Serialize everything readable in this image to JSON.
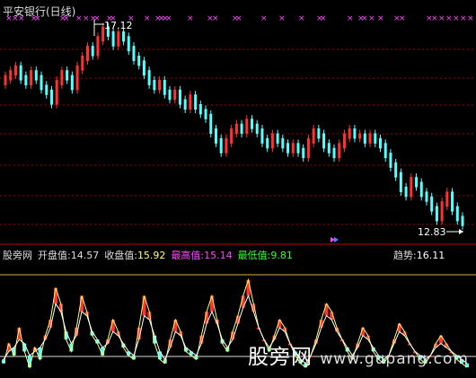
{
  "header": {
    "title": "平安银行(日线)"
  },
  "price_panel": {
    "high_label": "17.12",
    "low_label": "12.83"
  },
  "indicator_bar": {
    "name": "股旁网",
    "open_label": "开盘值:",
    "open_value": "14.57",
    "close_label": "收盘值:",
    "close_value": "15.92",
    "high_label": "最高值:",
    "high_value": "15.14",
    "low_label": "最低值:",
    "low_value": "9.81",
    "trend_label": "趋势:",
    "trend_value": "16.11"
  },
  "watermark": {
    "text": "股旁网",
    "url": "www.gupang.com"
  },
  "colors": {
    "up": "#ff3232",
    "down": "#54ffff",
    "grid": "#a00000",
    "yellow_line": "#ffff66",
    "white_line": "#ffffff",
    "magenta": "#ff44ff",
    "green": "#33ff33",
    "separator": "#c00000"
  },
  "chart_data": [
    {
      "type": "candlestick",
      "series": [
        {
          "name": "price",
          "values": [
            16.0,
            16.1,
            16.2,
            16.0,
            15.9,
            16.1,
            16.0,
            15.8,
            15.7,
            15.5,
            15.9,
            16.1,
            16.0,
            15.8,
            16.2,
            16.4,
            16.6,
            16.5,
            16.8,
            17.0,
            16.9,
            16.7,
            16.9,
            16.8,
            16.6,
            16.4,
            16.3,
            16.1,
            15.9,
            15.8,
            15.9,
            15.7,
            15.6,
            15.7,
            15.5,
            15.4,
            15.6,
            15.4,
            15.3,
            15.2,
            14.9,
            14.7,
            14.5,
            14.7,
            14.9,
            15.0,
            14.9,
            15.1,
            15.0,
            14.9,
            14.7,
            14.6,
            14.8,
            14.7,
            14.6,
            14.5,
            14.6,
            14.5,
            14.4,
            14.7,
            14.9,
            14.8,
            14.6,
            14.5,
            14.4,
            14.6,
            14.8,
            14.9,
            14.8,
            14.8,
            14.7,
            14.8,
            14.7,
            14.6,
            14.4,
            14.2,
            14.0,
            13.7,
            13.6,
            13.9,
            13.8,
            13.6,
            13.5,
            13.3,
            13.1,
            13.4,
            13.6,
            13.3,
            13.1,
            13.0
          ]
        }
      ],
      "ylim": [
        12.83,
        17.12
      ],
      "annotations": [
        "17.12",
        "12.83"
      ]
    },
    {
      "type": "line",
      "series": [
        {
          "name": "收盘值",
          "values": [
            3,
            8,
            5,
            12,
            6,
            2,
            7,
            4,
            10,
            14,
            22,
            18,
            9,
            6,
            12,
            20,
            16,
            10,
            8,
            5,
            9,
            14,
            11,
            7,
            5,
            4,
            12,
            20,
            16,
            8,
            4,
            3,
            9,
            14,
            11,
            6,
            5,
            4,
            10,
            16,
            20,
            14,
            8,
            6,
            11,
            15,
            20,
            24,
            18,
            12,
            9,
            6,
            10,
            14,
            12,
            8,
            5,
            3,
            2,
            5,
            9,
            14,
            18,
            16,
            12,
            9,
            6,
            4,
            8,
            12,
            10,
            6,
            4,
            3,
            5,
            9,
            13,
            11,
            8,
            6,
            4,
            3,
            5,
            8,
            10,
            8,
            6,
            4,
            3,
            2
          ]
        },
        {
          "name": "开盘值",
          "values": [
            4,
            6,
            7,
            9,
            8,
            5,
            6,
            7,
            9,
            12,
            18,
            16,
            11,
            8,
            10,
            16,
            15,
            11,
            9,
            7,
            8,
            11,
            10,
            8,
            6,
            5,
            9,
            15,
            14,
            10,
            6,
            4,
            7,
            11,
            10,
            7,
            6,
            5,
            8,
            13,
            16,
            13,
            9,
            7,
            9,
            13,
            17,
            20,
            16,
            12,
            9,
            7,
            9,
            12,
            11,
            8,
            6,
            4,
            3,
            5,
            8,
            12,
            15,
            14,
            11,
            9,
            7,
            5,
            7,
            10,
            9,
            7,
            5,
            4,
            5,
            8,
            11,
            10,
            8,
            6,
            5,
            4,
            5,
            7,
            8,
            7,
            6,
            5,
            4,
            3
          ]
        }
      ],
      "ylim": [
        0,
        28
      ]
    }
  ]
}
